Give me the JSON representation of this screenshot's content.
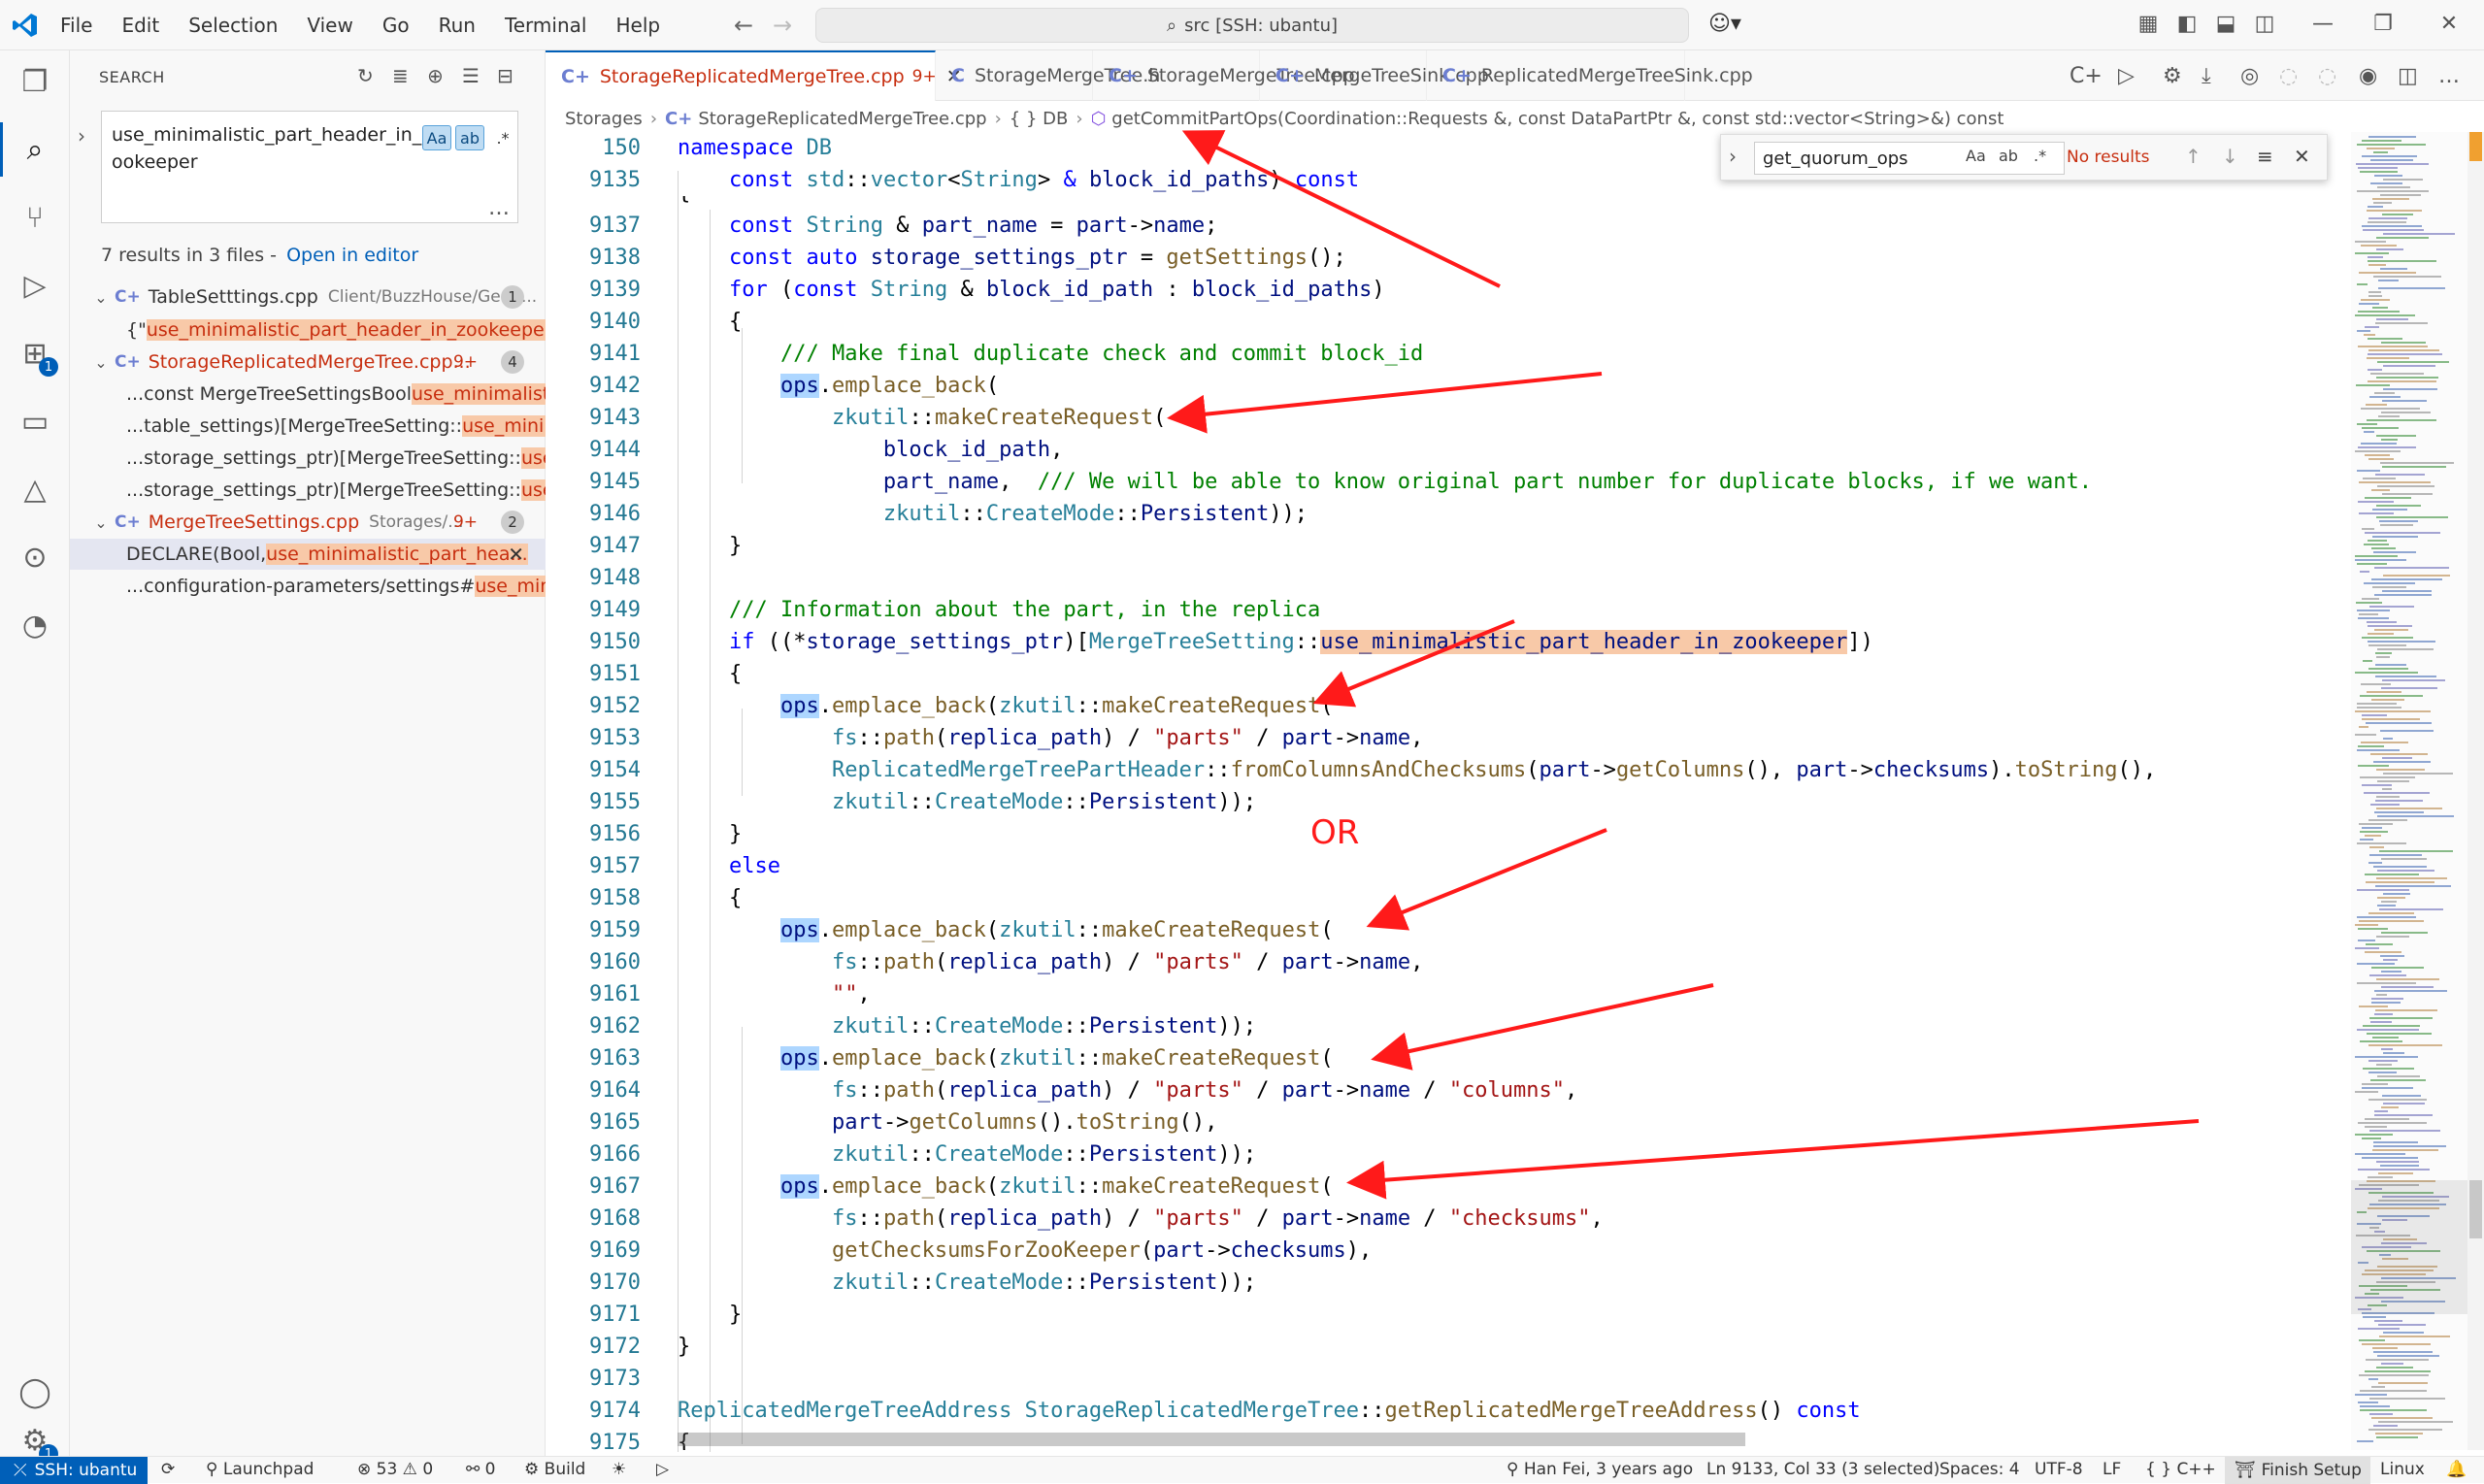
{
  "menu": [
    "File",
    "Edit",
    "Selection",
    "View",
    "Go",
    "Run",
    "Terminal",
    "Help"
  ],
  "command_center": "src [SSH: ubantu]",
  "sidebar": {
    "title": "SEARCH",
    "query": "use_minimalistic_part_header_in_zookeeper",
    "case_label": "Aa",
    "word_label": "ab",
    "regex_label": ".*",
    "results_text": "7 results in 3 files -",
    "open_in_editor": "Open in editor",
    "files": [
      {
        "name": "TableSetttings.cpp",
        "path": "Client/BuzzHouse/Gene...",
        "count": "1",
        "red": false,
        "nine": ""
      },
      {
        "name": "StorageReplicatedMergeTree.cpp...",
        "path": "",
        "count": "4",
        "red": true,
        "nine": "9+"
      },
      {
        "name": "MergeTreeSettings.cpp",
        "path": "Storages/...",
        "count": "2",
        "red": true,
        "nine": "9+"
      }
    ],
    "matches": [
      {
        "pre": "{\"",
        "hit": "use_minimalistic_part_header_in_zookeeper",
        "post": "\", ..."
      },
      {
        "pre": "...const MergeTreeSettingsBool ",
        "hit": "use_minimalistic...",
        "post": ""
      },
      {
        "pre": "...table_settings)[MergeTreeSetting::",
        "hit": "use_minimal...",
        "post": ""
      },
      {
        "pre": "...storage_settings_ptr)[MergeTreeSetting::",
        "hit": "use_...",
        "post": ""
      },
      {
        "pre": "...storage_settings_ptr)[MergeTreeSetting::",
        "hit": "use_...",
        "post": ""
      },
      {
        "pre": "DECLARE(Bool, ",
        "hit": "use_minimalistic_part_hea...",
        "post": ""
      },
      {
        "pre": "...configuration-parameters/settings#",
        "hit": "use_minim...",
        "post": ""
      }
    ]
  },
  "tabs": [
    {
      "label": "StorageReplicatedMergeTree.cpp",
      "badge": "9+",
      "icon": "C+",
      "active": true
    },
    {
      "label": "StorageMergeTree.h",
      "badge": "",
      "icon": "C",
      "active": false
    },
    {
      "label": "StorageMergeTree.cpp",
      "badge": "",
      "icon": "C+",
      "active": false
    },
    {
      "label": "MergeTreeSink.cpp",
      "badge": "",
      "icon": "C+",
      "active": false
    },
    {
      "label": "ReplicatedMergeTreeSink.cpp",
      "badge": "",
      "icon": "C+",
      "active": false
    }
  ],
  "breadcrumb": {
    "p1": "Storages",
    "p2": "StorageReplicatedMergeTree.cpp",
    "p3": "{ } DB",
    "p4": "getCommitPartOps(Coordination::Requests &, const DataPartPtr &, const std::vector<String>&) const"
  },
  "find": {
    "value": "get_quorum_ops",
    "result": "No results",
    "opt_case": "Aa",
    "opt_word": "ab",
    "opt_regex": ".*"
  },
  "annotation_or": "OR",
  "status": {
    "remote": "SSH: ubantu",
    "launchpad": "Launchpad",
    "problems": "⊗ 53 ⚠ 0",
    "ports": "0",
    "build": "Build",
    "blame": "Han Fei, 3 years ago",
    "position": "Ln 9133, Col 33 (3 selected)",
    "spaces": "Spaces: 4",
    "encoding": "UTF-8",
    "eol": "LF",
    "language": "{ } C++",
    "finish": "Finish Setup",
    "os": "Linux"
  }
}
